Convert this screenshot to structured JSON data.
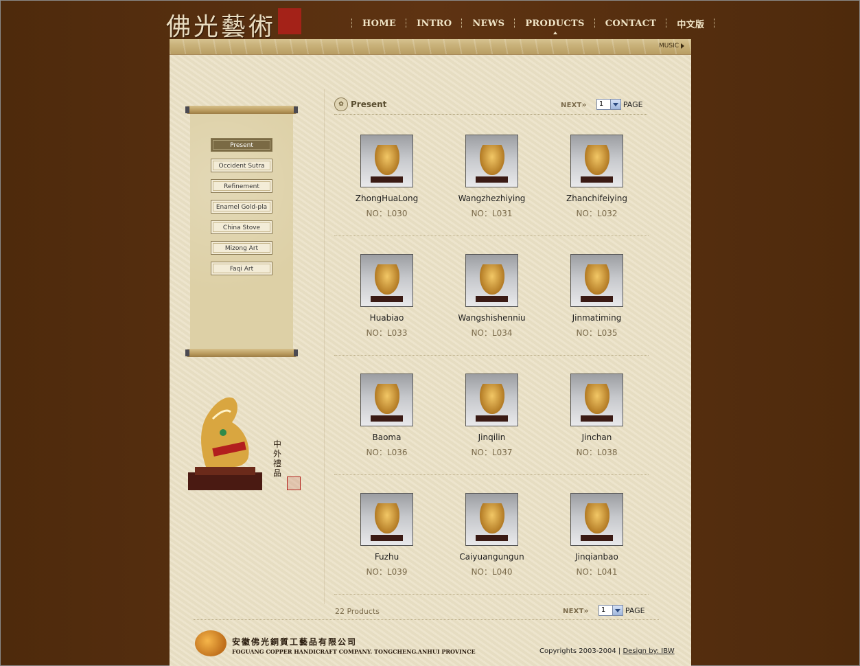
{
  "header": {
    "logo_text": "佛光藝術",
    "nav": [
      {
        "label": "HOME",
        "active": false
      },
      {
        "label": "INTRO",
        "active": false
      },
      {
        "label": "NEWS",
        "active": false
      },
      {
        "label": "PRODUCTS",
        "active": true
      },
      {
        "label": "CONTACT",
        "active": false
      },
      {
        "label": "中文版",
        "active": false
      }
    ],
    "music_label": "MUSIC"
  },
  "sidebar": {
    "categories": [
      {
        "label": "Present",
        "active": true
      },
      {
        "label": "Occident Sutra",
        "active": false
      },
      {
        "label": "Refinement",
        "active": false
      },
      {
        "label": "Enamel Gold-pla",
        "active": false
      },
      {
        "label": "China Stove",
        "active": false
      },
      {
        "label": "Mizong Art",
        "active": false
      },
      {
        "label": "Faqi Art",
        "active": false
      }
    ],
    "gift_caption": "中外禮品"
  },
  "content": {
    "section_title": "Present",
    "pager_top": {
      "next_label": "NEXT",
      "page_value": "1",
      "page_label": "PAGE"
    },
    "products": [
      {
        "name": "ZhongHuaLong",
        "no": "NO：L030"
      },
      {
        "name": "Wangzhezhiying",
        "no": "NO：L031"
      },
      {
        "name": "Zhanchifeiying",
        "no": "NO：L032"
      },
      {
        "name": "Huabiao",
        "no": "NO：L033"
      },
      {
        "name": "Wangshishenniu",
        "no": "NO：L034"
      },
      {
        "name": "Jinmatiming",
        "no": "NO：L035"
      },
      {
        "name": "Baoma",
        "no": "NO：L036"
      },
      {
        "name": "Jinqilin",
        "no": "NO：L037"
      },
      {
        "name": "Jinchan",
        "no": "NO：L038"
      },
      {
        "name": "Fuzhu",
        "no": "NO：L039"
      },
      {
        "name": "Caiyuangungun",
        "no": "NO：L040"
      },
      {
        "name": "Jinqianbao",
        "no": "NO：L041"
      }
    ],
    "product_count": "22 Products",
    "pager_bottom": {
      "next_label": "NEXT",
      "page_value": "1",
      "page_label": "PAGE"
    }
  },
  "footer": {
    "company_cn": "安徽佛光銅質工藝品有限公司",
    "company_en": "FOGUANG COPPER HANDICRAFT COMPANY. TONGCHENG.ANHUI PROVINCE",
    "copyright": "Copyrights 2003-2004 | ",
    "design_link": "Design by: IBW"
  },
  "colors": {
    "background": "#5a3010",
    "parchment": "#ebe1c6",
    "accent": "#7a6a44"
  }
}
